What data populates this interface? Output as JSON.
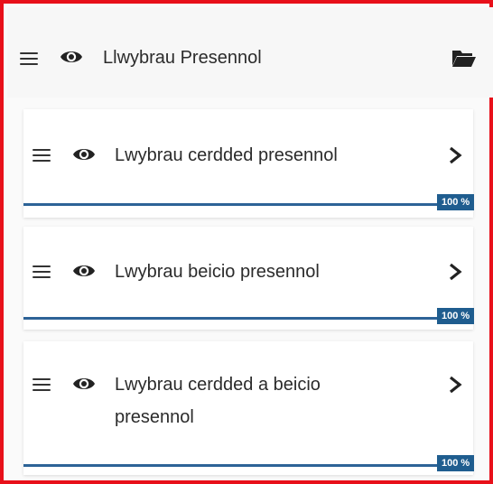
{
  "group": {
    "title": "Llwybrau Presennol",
    "icons": [
      "menu-icon",
      "eye-icon",
      "folder-open-icon"
    ]
  },
  "layers": [
    {
      "title": "Lwybrau cerdded presennol",
      "progress_label": "100 %",
      "progress_value": 1.0
    },
    {
      "title": "Lwybrau beicio presennol",
      "progress_label": "100 %",
      "progress_value": 1.0
    },
    {
      "title_line1": "Lwybrau cerdded a beicio",
      "title_line2": "presennol",
      "progress_label": "100 %",
      "progress_value": 1.0
    }
  ],
  "colors": {
    "frame_border": "#e8101a",
    "progress": "#2d6397",
    "badge": "#1f5d8f"
  }
}
